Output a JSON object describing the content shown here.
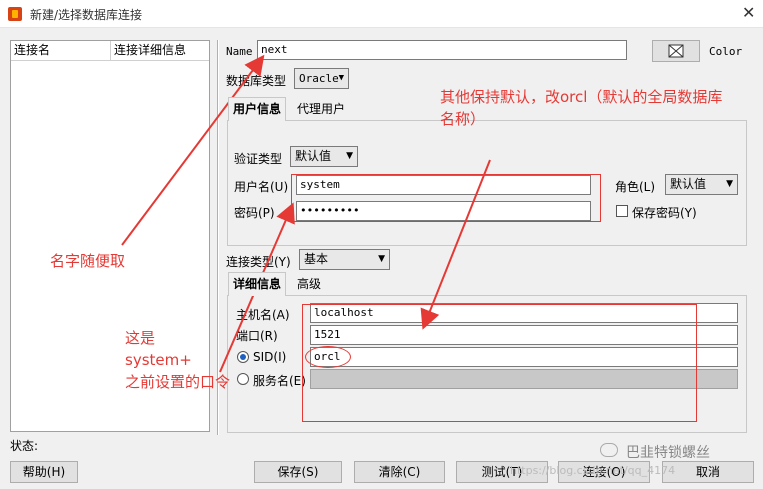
{
  "window": {
    "title": "新建/选择数据库连接",
    "close": "✕"
  },
  "connections": {
    "col_name": "连接名",
    "col_detail": "连接详细信息"
  },
  "name": {
    "label": "Name",
    "value": "next"
  },
  "color": {
    "label": "Color"
  },
  "db_type": {
    "label": "数据库类型",
    "value": "Oracle"
  },
  "user_tabs": {
    "tab1": "用户信息",
    "tab2": "代理用户"
  },
  "auth": {
    "label": "验证类型",
    "value": "默认值"
  },
  "username": {
    "label": "用户名(U)",
    "value": "system"
  },
  "password": {
    "label": "密码(P)",
    "value": "•••••••••"
  },
  "role": {
    "label": "角色(L)",
    "value": "默认值"
  },
  "save_password": {
    "label": "保存密码(Y)"
  },
  "conn_type": {
    "label": "连接类型(Y)",
    "value": "基本"
  },
  "detail_tabs": {
    "tab1": "详细信息",
    "tab2": "高级"
  },
  "host": {
    "label": "主机名(A)",
    "value": "localhost"
  },
  "port": {
    "label": "端口(R)",
    "value": "1521"
  },
  "sid": {
    "label": "SID(I)",
    "value": "orcl"
  },
  "service": {
    "label": "服务名(E)",
    "value": ""
  },
  "status": {
    "label": "状态:"
  },
  "buttons": {
    "help": "帮助(H)",
    "save": "保存(S)",
    "clear": "清除(C)",
    "test": "测试(T)",
    "connect": "连接(O)",
    "cancel": "取消"
  },
  "annotations": {
    "top_line1": "其他保持默认，改orcl（默认的全局数据库",
    "top_line2": "名称）",
    "name_hint": "名字随便取",
    "sys_line1": "这是",
    "sys_line2": "system+",
    "sys_line3": "之前设置的口令"
  },
  "watermark": {
    "brand": "巴韭特锁螺丝",
    "url": "https://blog.csdn.net/qq_4174"
  },
  "colors": {
    "annotation": "#e53935",
    "selection": "#1e5fbf"
  }
}
